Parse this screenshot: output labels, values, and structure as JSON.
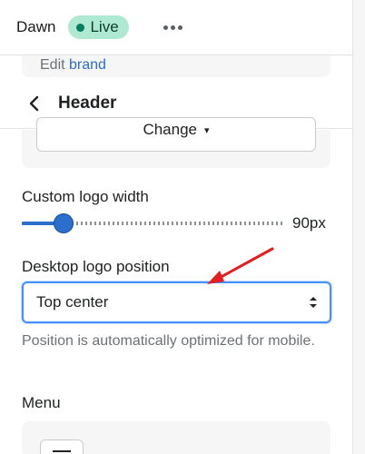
{
  "topbar": {
    "theme_name": "Dawn",
    "status_badge": "Live",
    "more_icon": "more-horizontal-icon"
  },
  "breadcrumb_peek": {
    "prefix": "Edit",
    "link": "brand"
  },
  "header": {
    "back_icon": "chevron-left-icon",
    "title": "Header"
  },
  "logo_card": {
    "change_button_label": "Change",
    "caret_icon": "caret-down-icon"
  },
  "custom_logo_width": {
    "label": "Custom logo width",
    "value": 90,
    "min": 50,
    "max": 300,
    "value_display": "90px"
  },
  "desktop_logo_position": {
    "label": "Desktop logo position",
    "selected": "Top center",
    "help_text": "Position is automatically optimized for mobile."
  },
  "menu": {
    "label": "Menu"
  },
  "colors": {
    "accent": "#2c6ecb",
    "live_badge_bg": "#aee9d1",
    "live_dot": "#007f5f",
    "annotation_arrow": "#e41e1e",
    "focus_border": "#458fff"
  }
}
